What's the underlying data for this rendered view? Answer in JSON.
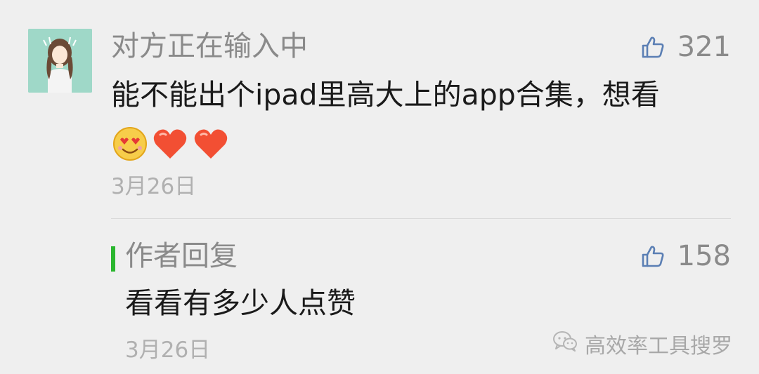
{
  "comment": {
    "username": "对方正在输入中",
    "like_count": "321",
    "text": "能不能出个ipad里高大上的app合集，想看",
    "emojis": [
      "heart-eyes-face",
      "heart",
      "heart"
    ],
    "date": "3月26日"
  },
  "reply": {
    "title": "作者回复",
    "like_count": "158",
    "text": "看看有多少人点赞",
    "date": "3月26日"
  },
  "watermark": {
    "text": "高效率工具搜罗"
  },
  "colors": {
    "background": "#efefef",
    "meta_text": "#8a8a8a",
    "body_text": "#1a1a1a",
    "accent_green": "#2ab62e",
    "like_icon": "#5b7fb4"
  }
}
